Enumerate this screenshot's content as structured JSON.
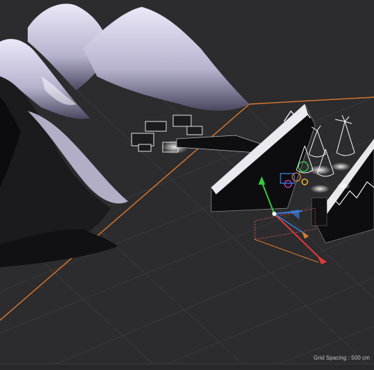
{
  "viewport": {
    "grid_spacing_text": "Grid Spacing : 500 cm",
    "background_color": "#2c2c2e",
    "grid_color": "#3a3a3d",
    "world_axis_color": "#e07a2e",
    "terrain_color": "#d9d6ec",
    "gizmo": {
      "x_axis_color": "#e23a3a",
      "y_axis_color": "#2ecc40",
      "z_axis_color": "#3a7fe0"
    }
  }
}
